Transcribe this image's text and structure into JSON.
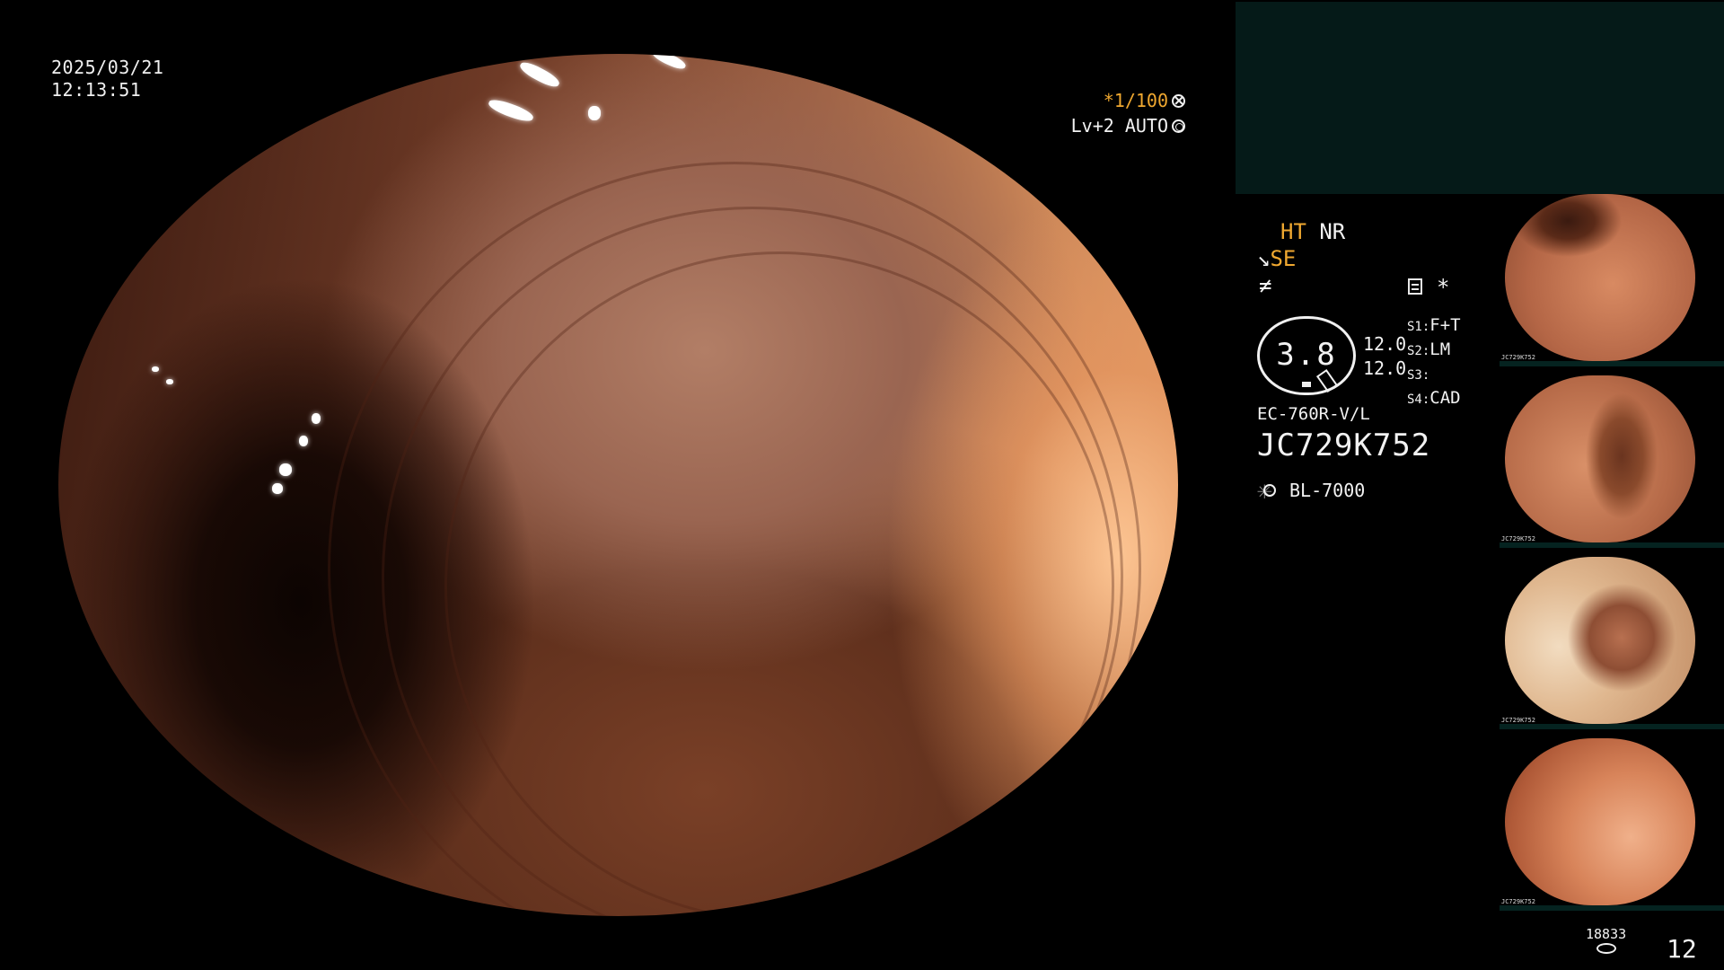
{
  "overlay": {
    "date": "2025/03/21",
    "time": "12:13:51",
    "shutter": "*1/100",
    "level_mode": "Lv+2 AUTO"
  },
  "processing": {
    "ht": "HT",
    "nr": "NR",
    "se": "SE",
    "gauge_value": "3.8",
    "gain_1": "12.0",
    "gain_2": "12.0",
    "settings": [
      {
        "key": "S1:",
        "value": "F+T"
      },
      {
        "key": "S2:",
        "value": "LM"
      },
      {
        "key": "S3:",
        "value": ""
      },
      {
        "key": "S4:",
        "value": "CAD"
      }
    ],
    "asterisk": "*",
    "scope_model": "EC-760R-V/L",
    "scope_serial": "JC729K752",
    "light_source": "BL-7000"
  },
  "thumbnails": [
    {
      "caption": "JC729K752"
    },
    {
      "caption": "JC729K752"
    },
    {
      "caption": "JC729K752"
    },
    {
      "caption": "JC729K752"
    }
  ],
  "footer": {
    "storage_count": "18833",
    "frame_count": "12"
  },
  "colors": {
    "accent_orange": "#f0a830",
    "panel_teal": "#051a18",
    "text": "#f2f2f2"
  },
  "icons": {
    "shutter": "cross-circle-icon",
    "auto": "ring-circle-icon",
    "light": "sun-icon",
    "storage": "disk-icon"
  }
}
